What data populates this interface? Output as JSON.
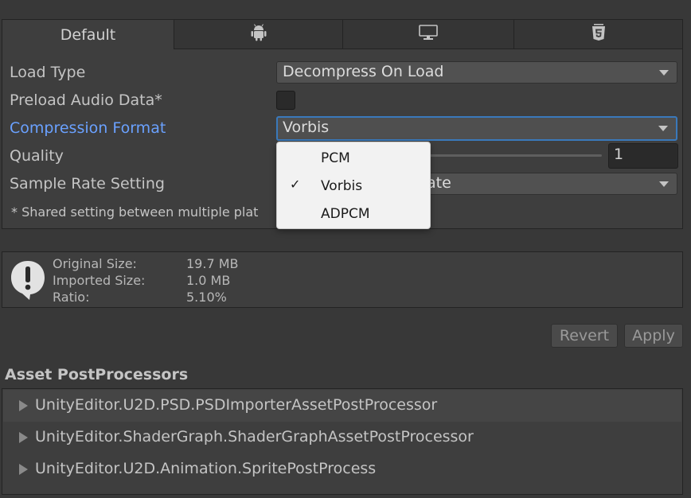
{
  "tabs": [
    {
      "label": "Default"
    },
    {
      "icon": "android-icon"
    },
    {
      "icon": "monitor-icon"
    },
    {
      "icon": "html5-icon"
    }
  ],
  "settings": {
    "load_type_label": "Load Type",
    "load_type_value": "Decompress On Load",
    "preload_label": "Preload Audio Data*",
    "preload_checked": false,
    "compression_label": "Compression Format",
    "compression_value": "Vorbis",
    "quality_label": "Quality",
    "quality_value": "1",
    "sample_rate_label": "Sample Rate Setting",
    "sample_rate_value_visible": "ate",
    "shared_note": "* Shared setting between multiple plat"
  },
  "compression_menu": {
    "options": [
      "PCM",
      "Vorbis",
      "ADPCM"
    ],
    "selected": "Vorbis",
    "check_glyph": "✓"
  },
  "info": {
    "icon": "warning-speech-bubble-icon",
    "original_label": "Original Size:",
    "original_value": "19.7 MB",
    "imported_label": "Imported Size:",
    "imported_value": "1.0 MB",
    "ratio_label": "Ratio:",
    "ratio_value": "5.10%"
  },
  "buttons": {
    "revert": "Revert",
    "apply": "Apply"
  },
  "post_processors": {
    "title": "Asset PostProcessors",
    "items": [
      "UnityEditor.U2D.PSD.PSDImporterAssetPostProcessor",
      "UnityEditor.ShaderGraph.ShaderGraphAssetPostProcessor",
      "UnityEditor.U2D.Animation.SpritePostProcess"
    ]
  },
  "colors": {
    "background": "#383838",
    "panel": "#3e3e3e",
    "focus_label": "#6aa1ff",
    "focus_border": "#3a79bb",
    "popup_bg": "#f2f2f2"
  }
}
